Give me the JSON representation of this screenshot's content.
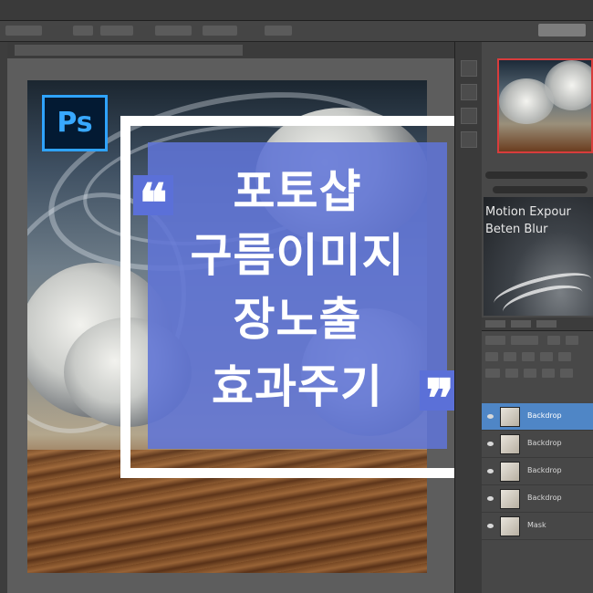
{
  "app": {
    "name": "Photoshop",
    "logo_text": "Ps"
  },
  "headline": {
    "lines": [
      "포토샵",
      "구름이미지",
      "장노출",
      "효과주기"
    ],
    "open_quote": "❝",
    "close_quote": "❞"
  },
  "filter_preview": {
    "line1": "Motion Expour",
    "line2": "Beten Blur"
  },
  "layers": [
    {
      "name": "Backdrop",
      "active": true
    },
    {
      "name": "Backdrop",
      "active": false
    },
    {
      "name": "Backdrop",
      "active": false
    },
    {
      "name": "Backdrop",
      "active": false
    },
    {
      "name": "Mask",
      "active": false
    }
  ],
  "colors": {
    "title_box": "#6074d6",
    "ps_logo_border": "#2fa3ff",
    "active_layer": "#4f86c6",
    "navigator_frame": "#d83c3c"
  }
}
